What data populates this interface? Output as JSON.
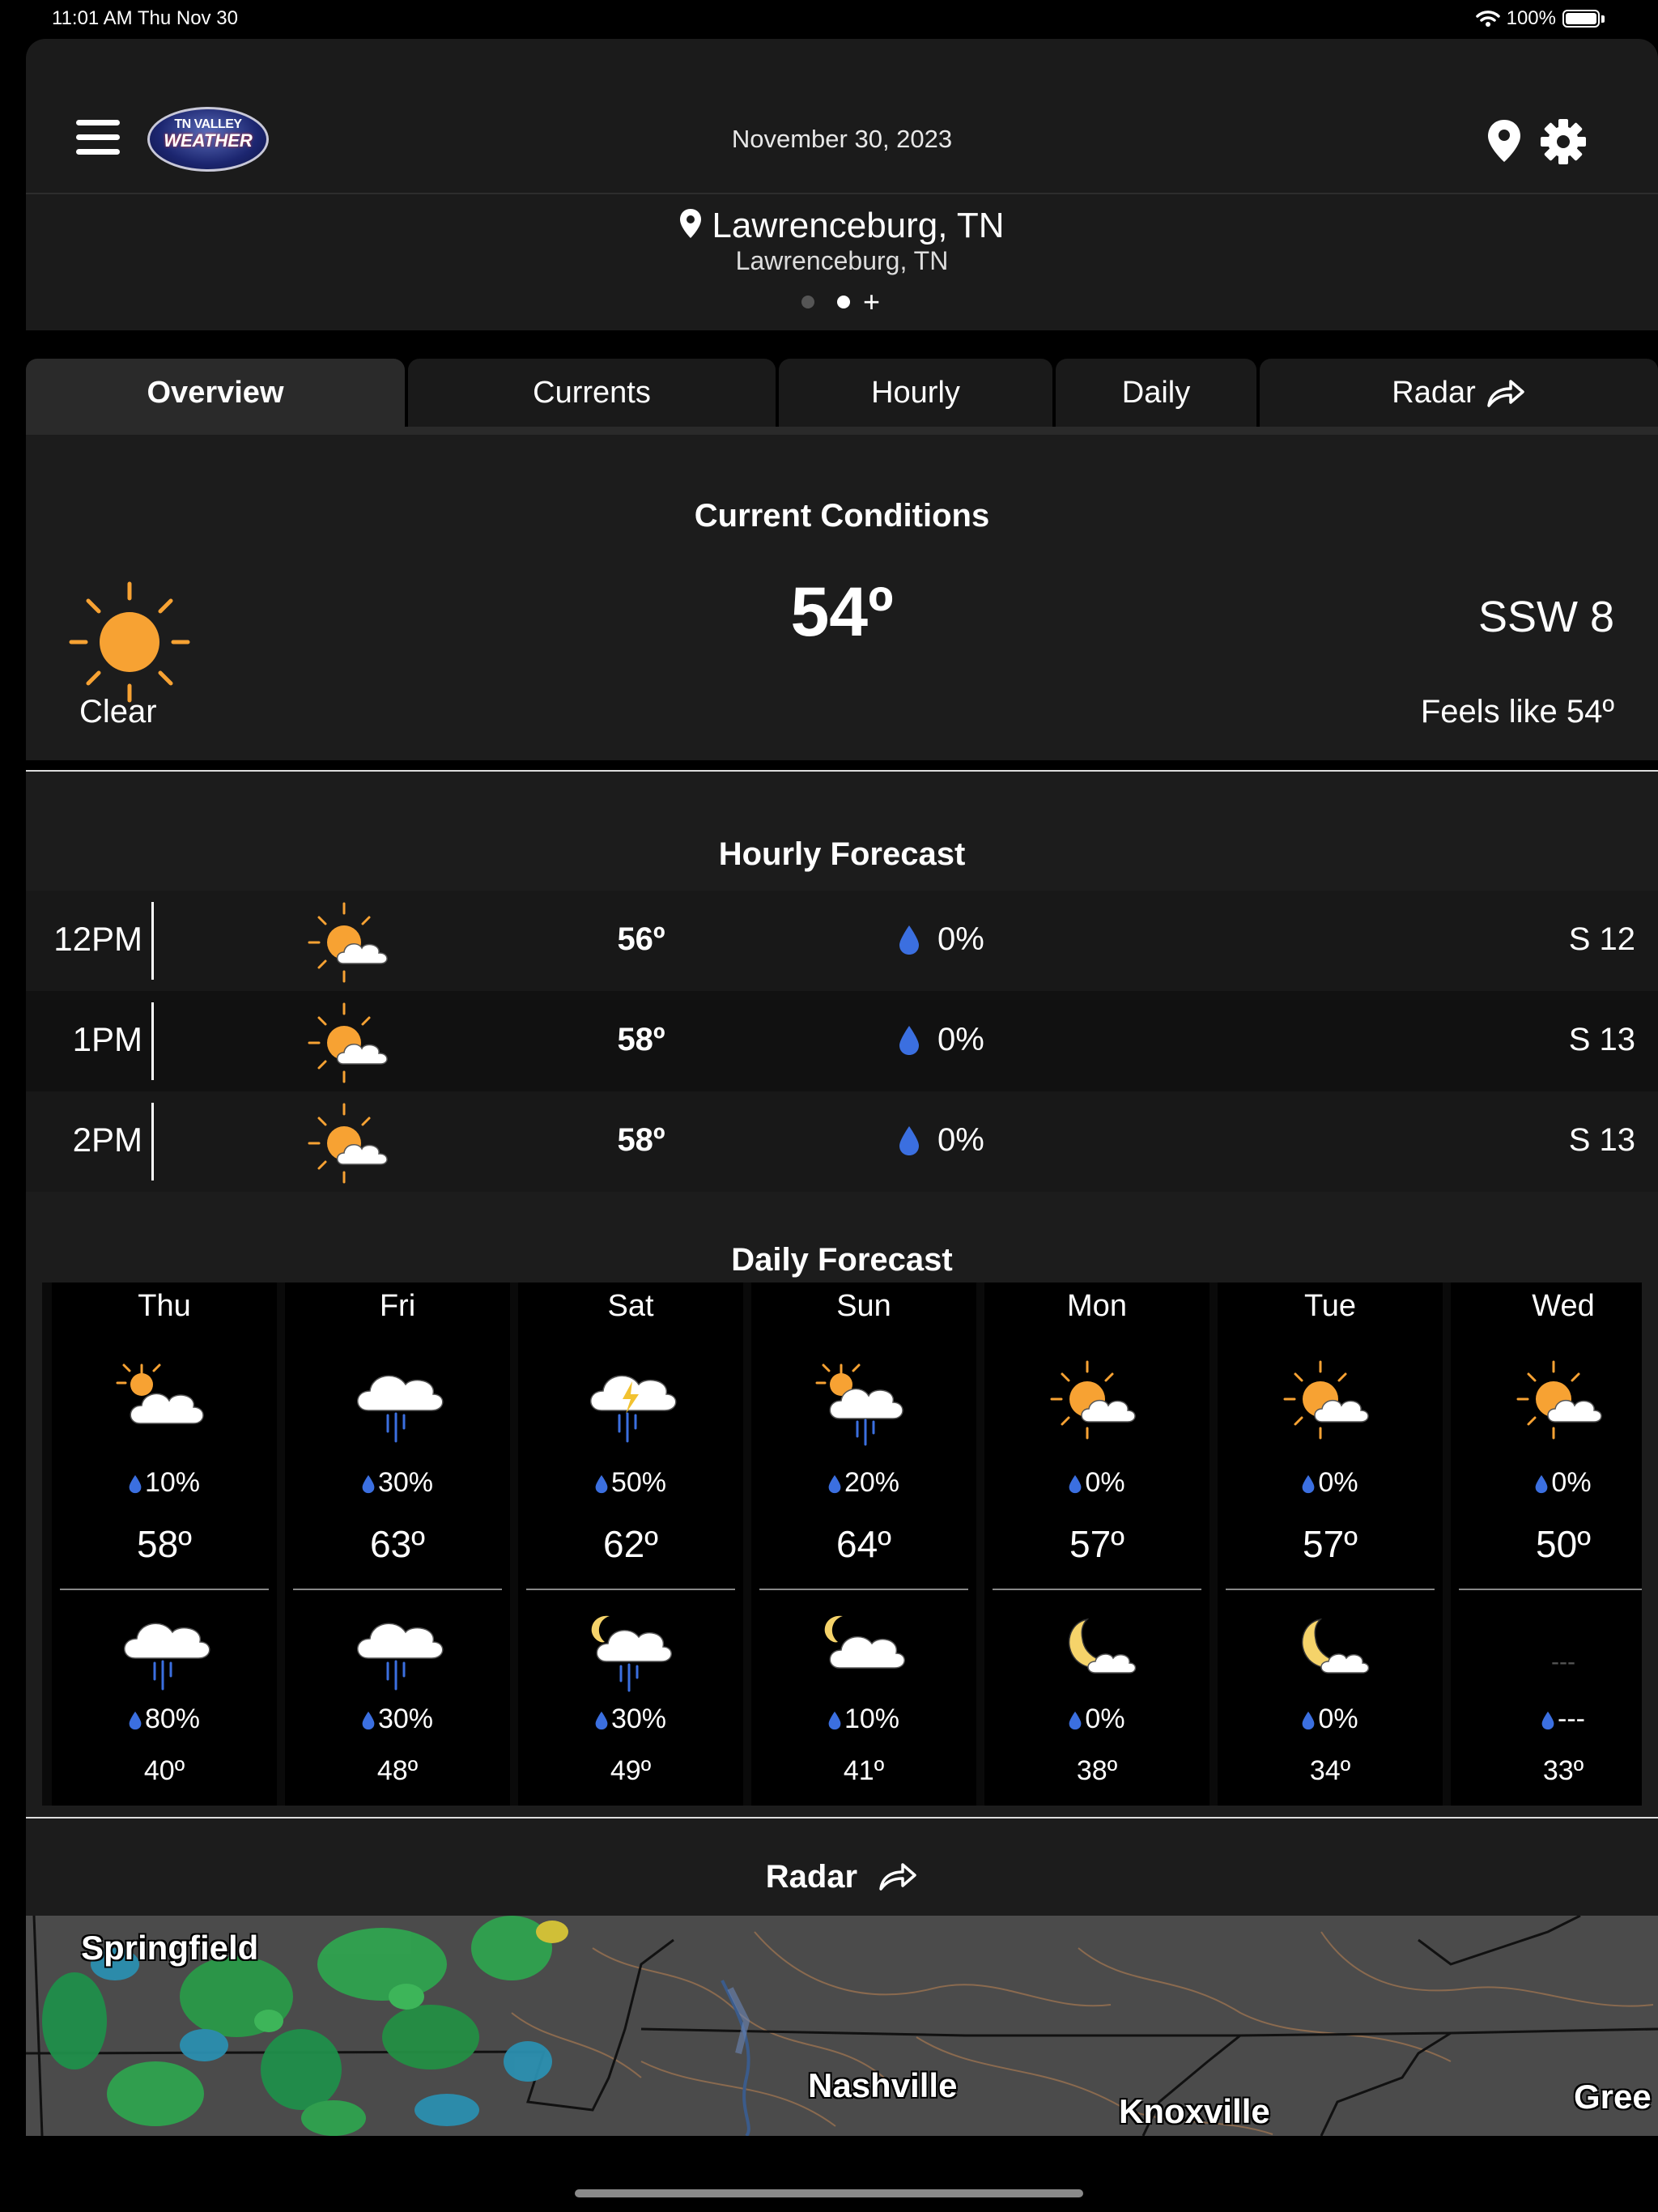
{
  "status_bar": {
    "time_date": "11:01 AM   Thu Nov 30",
    "battery": "100%"
  },
  "header": {
    "logo_line1": "TN VALLEY",
    "logo_line2": "WEATHER",
    "date": "November 30, 2023",
    "location_name": "Lawrenceburg, TN",
    "location_sub": "Lawrenceburg, TN",
    "add_location": "+"
  },
  "tabs": [
    {
      "label": "Overview"
    },
    {
      "label": "Currents"
    },
    {
      "label": "Hourly"
    },
    {
      "label": "Daily"
    },
    {
      "label": "Radar"
    }
  ],
  "current": {
    "title": "Current Conditions",
    "temp": "54º",
    "wind": "SSW 8",
    "condition": "Clear",
    "feels_like": "Feels like 54º",
    "icon": "sun-icon"
  },
  "hourly": {
    "title": "Hourly Forecast",
    "rows": [
      {
        "time": "12PM",
        "temp": "56º",
        "precip": "0%",
        "wind": "S 12",
        "icon": "partly-cloudy-icon"
      },
      {
        "time": "1PM",
        "temp": "58º",
        "precip": "0%",
        "wind": "S 13",
        "icon": "partly-cloudy-icon"
      },
      {
        "time": "2PM",
        "temp": "58º",
        "precip": "0%",
        "wind": "S 13",
        "icon": "partly-cloudy-icon"
      }
    ]
  },
  "daily": {
    "title": "Daily Forecast",
    "days": [
      {
        "name": "Thu",
        "day_icon": "mostly-cloudy-icon",
        "day_precip": "10%",
        "high": "58º",
        "night_icon": "rain-icon",
        "night_precip": "80%",
        "low": "40º"
      },
      {
        "name": "Fri",
        "day_icon": "rain-icon",
        "day_precip": "30%",
        "high": "63º",
        "night_icon": "rain-icon",
        "night_precip": "30%",
        "low": "48º"
      },
      {
        "name": "Sat",
        "day_icon": "thunderstorm-icon",
        "day_precip": "50%",
        "high": "62º",
        "night_icon": "night-rain-icon",
        "night_precip": "30%",
        "low": "49º"
      },
      {
        "name": "Sun",
        "day_icon": "sun-rain-icon",
        "day_precip": "20%",
        "high": "64º",
        "night_icon": "night-cloudy-icon",
        "night_precip": "10%",
        "low": "41º"
      },
      {
        "name": "Mon",
        "day_icon": "partly-cloudy-icon",
        "day_precip": "0%",
        "high": "57º",
        "night_icon": "moon-cloud-icon",
        "night_precip": "0%",
        "low": "38º"
      },
      {
        "name": "Tue",
        "day_icon": "partly-cloudy-icon",
        "day_precip": "0%",
        "high": "57º",
        "night_icon": "moon-cloud-icon",
        "night_precip": "0%",
        "low": "34º"
      },
      {
        "name": "Wed",
        "day_icon": "partly-cloudy-icon",
        "day_precip": "0%",
        "high": "50º",
        "night_icon": "---",
        "night_precip": "---",
        "low": "33º"
      }
    ]
  },
  "radar": {
    "title": "Radar",
    "cities": [
      "Springfield",
      "Nashville",
      "Knoxville",
      "Gree"
    ]
  },
  "colors": {
    "sun": "#f7a233",
    "drop": "#3b6fe0",
    "panel": "#1c1c1c",
    "header": "#1b1b1b",
    "rain_streak": "#3b6fe0"
  }
}
